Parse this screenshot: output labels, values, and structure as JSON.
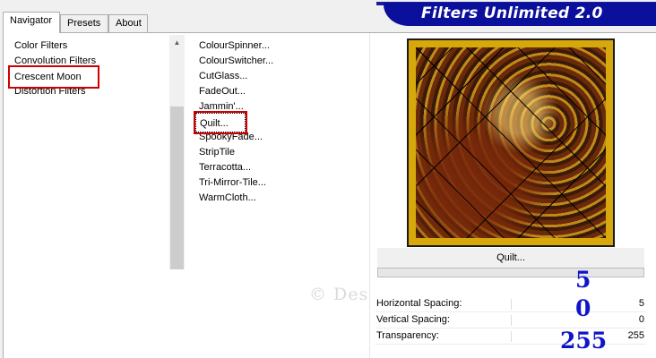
{
  "header": {
    "title": "Filters Unlimited 2.0"
  },
  "tabs": [
    {
      "label": "Navigator",
      "active": true
    },
    {
      "label": "Presets",
      "active": false
    },
    {
      "label": "About",
      "active": false
    }
  ],
  "categories": [
    {
      "label": "Color Filters"
    },
    {
      "label": "Convolution Filters"
    },
    {
      "label": "Crescent Moon",
      "selected": true
    },
    {
      "label": "Distortion Filters"
    }
  ],
  "filters": [
    {
      "label": "ColourSpinner..."
    },
    {
      "label": "ColourSwitcher..."
    },
    {
      "label": "CutGlass..."
    },
    {
      "label": "FadeOut..."
    },
    {
      "label": "Jammin'..."
    },
    {
      "label": "Quilt...",
      "selected": true
    },
    {
      "label": "SpookyFade..."
    },
    {
      "label": "StripTile"
    },
    {
      "label": "Terracotta..."
    },
    {
      "label": "Tri-Mirror-Tile..."
    },
    {
      "label": "WarmCloth..."
    }
  ],
  "preview": {
    "filter_name": "Quilt..."
  },
  "params": [
    {
      "label": "Horizontal Spacing:",
      "value": "5"
    },
    {
      "label": "Vertical Spacing:",
      "value": "0"
    },
    {
      "label": "Transparency:",
      "value": "255"
    }
  ],
  "annotations": {
    "h_spacing": "5",
    "v_spacing": "0",
    "transparency": "255"
  },
  "watermark": "© Des",
  "colors": {
    "selection_outline": "#d10000",
    "banner": "#0a0f9c",
    "annotation": "#1016c8",
    "frame": "#d6a80c"
  }
}
